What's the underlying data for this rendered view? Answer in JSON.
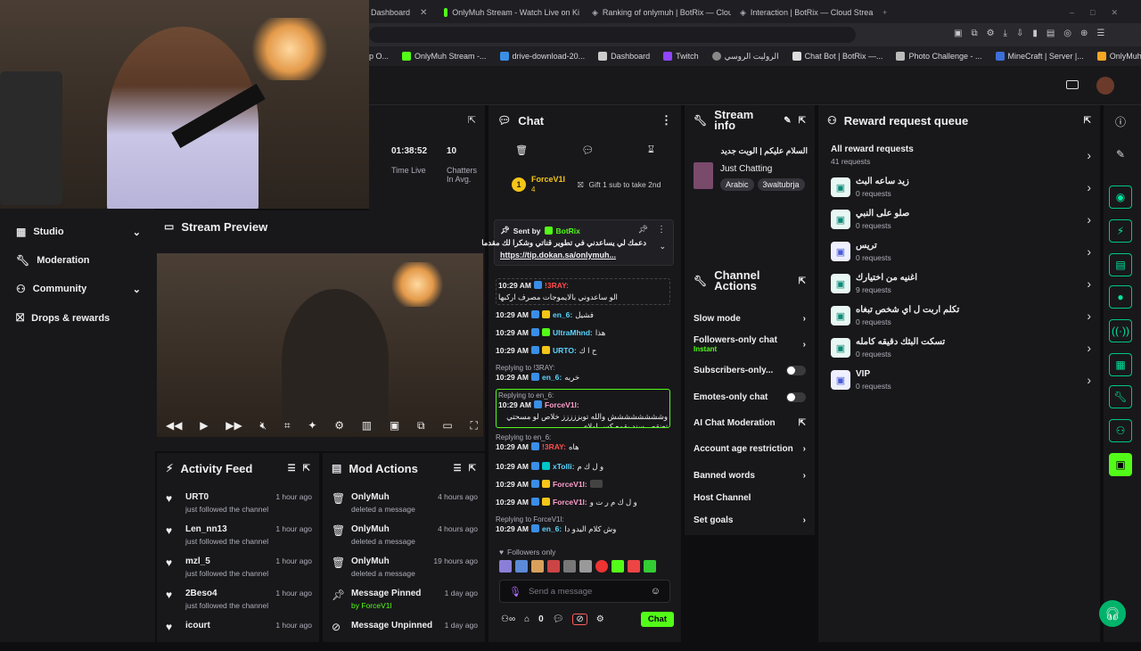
{
  "browser": {
    "tabs": [
      {
        "label": "Dashboard"
      },
      {
        "label": "OnlyMuh Stream - Watch Live on Ki"
      },
      {
        "label": "Ranking of onlymuh | BotRix — Clou"
      },
      {
        "label": "Interaction | BotRix — Cloud Strea"
      }
    ],
    "bookmarks": [
      "p O...",
      "OnlyMuh Stream -...",
      "drive-download-20...",
      "Dashboard",
      "Twitch",
      "الروليت الروسي",
      "Chat Bot | BotRix —...",
      "Photo Challenge - ...",
      "MineCraft | Server |...",
      "OnlyMuh verification"
    ]
  },
  "stats": {
    "time_live": "01:38:52",
    "time_live_label": "Time Live",
    "chatters": "10",
    "chatters_label": "Chatters In Avg."
  },
  "sidebar": {
    "items": [
      {
        "label": "Studio"
      },
      {
        "label": "Moderation"
      },
      {
        "label": "Community"
      },
      {
        "label": "Drops & rewards"
      }
    ]
  },
  "preview": {
    "title": "Stream Preview"
  },
  "activity": {
    "title": "Activity Feed",
    "rows": [
      {
        "name": "URT0",
        "desc": "just followed the channel",
        "time": "1 hour ago"
      },
      {
        "name": "Len_nn13",
        "desc": "just followed the channel",
        "time": "1 hour ago"
      },
      {
        "name": "mzl_5",
        "desc": "just followed the channel",
        "time": "1 hour ago"
      },
      {
        "name": "2Beso4",
        "desc": "just followed the channel",
        "time": "1 hour ago"
      },
      {
        "name": "icourt",
        "desc": "",
        "time": "1 hour ago"
      }
    ]
  },
  "modactions": {
    "title": "Mod Actions",
    "rows": [
      {
        "name": "OnlyMuh",
        "desc": "deleted a message",
        "time": "4 hours ago"
      },
      {
        "name": "OnlyMuh",
        "desc": "deleted a message",
        "time": "4 hours ago"
      },
      {
        "name": "OnlyMuh",
        "desc": "deleted a message",
        "time": "19 hours ago"
      },
      {
        "name": "Message Pinned",
        "desc": "by ForceV1l",
        "time": "1 day ago"
      },
      {
        "name": "Message Unpinned",
        "desc": "",
        "time": "1 day ago"
      }
    ]
  },
  "chat": {
    "title": "Chat",
    "gift_user": "ForceV1l",
    "gift_count": "4",
    "gift_text": "Gift 1 sub to take 2nd",
    "pinned_sent_by": "Sent by",
    "pinned_user": "BotRix",
    "pinned_text": "دعمك لي يساعدني في تطوير قناتي وشكرا لك مقدما",
    "pinned_link": "https://tip.dokan.sa/onlymuh...",
    "messages": [
      {
        "time": "10:29 AM",
        "user": "!3RAY:",
        "text": "الو ساعدوني بالايموجات مصرف اركبها"
      },
      {
        "time": "10:29 AM",
        "user": "en_6:",
        "text": "فشيل"
      },
      {
        "time": "10:29 AM",
        "user": "UltraMhnd:",
        "text": "هذا"
      },
      {
        "time": "10:29 AM",
        "user": "URTO:",
        "text": "ح ا ك"
      },
      {
        "reply": "Replying to !3RAY:",
        "time": "10:29 AM",
        "user": "en_6:",
        "text": "خربه"
      },
      {
        "reply": "Replying to en_6:",
        "time": "10:29 AM",
        "user": "ForceV1l:",
        "text": "وشششششششش والله توبززززز خلاص لو مسحتي تعنقص سند يقمع كس اولاي"
      },
      {
        "reply": "Replying to en_6:",
        "time": "10:29 AM",
        "user": "!3RAY:",
        "text": "هاه"
      },
      {
        "time": "10:29 AM",
        "user": "xTolli:",
        "text": "و ل ك م"
      },
      {
        "time": "10:29 AM",
        "user": "ForceV1l:",
        "text": ""
      },
      {
        "time": "10:29 AM",
        "user": "ForceV1l:",
        "text": "و ل ك م ر ت و"
      },
      {
        "reply": "Replying to ForceV1l:",
        "time": "10:29 AM",
        "user": "en_6:",
        "text": "وش كلام اليدو دا"
      }
    ],
    "followers_only": "Followers only",
    "placeholder": "Send a message",
    "count": "0",
    "send_label": "Chat"
  },
  "streaminfo": {
    "title": "Stream info",
    "stream_title": "السلام عليكم | الويت جديد",
    "category": "Just Chatting",
    "tags": [
      "Arabic",
      "3waltubrja"
    ]
  },
  "channelactions": {
    "title": "Channel Actions",
    "items": [
      {
        "label": "Slow mode",
        "kind": "arrow"
      },
      {
        "label": "Followers-only chat",
        "sub": "Instant",
        "kind": "arrow"
      },
      {
        "label": "Subscribers-only...",
        "kind": "toggle"
      },
      {
        "label": "Emotes-only chat",
        "kind": "toggle"
      },
      {
        "label": "AI Chat Moderation",
        "kind": "ext"
      },
      {
        "label": "Account age restriction",
        "kind": "arrow"
      },
      {
        "label": "Banned words",
        "kind": "arrow"
      },
      {
        "label": "Host Channel",
        "kind": "none"
      },
      {
        "label": "Set goals",
        "kind": "arrow"
      }
    ]
  },
  "rewards": {
    "title": "Reward request queue",
    "all_label": "All reward requests",
    "all_count": "41 requests",
    "items": [
      {
        "title": "زيد ساعه البث",
        "count": "0 requests"
      },
      {
        "title": "صلو على النبي",
        "count": "0 requests"
      },
      {
        "title": "تريس",
        "count": "0 requests"
      },
      {
        "title": "اغنيه من اختيارك",
        "count": "9 requests"
      },
      {
        "title": "تكلم اربت ل اي شخص تبغاه",
        "count": "0 requests"
      },
      {
        "title": "تسكت البثك دقيقه كامله",
        "count": "0 requests"
      },
      {
        "title": "VIP",
        "count": "0 requests"
      }
    ]
  },
  "colors": {
    "accent": "#53fc18",
    "kick_green": "#00e5a0",
    "panel": "#18181b",
    "bg": "#0e0e10"
  }
}
